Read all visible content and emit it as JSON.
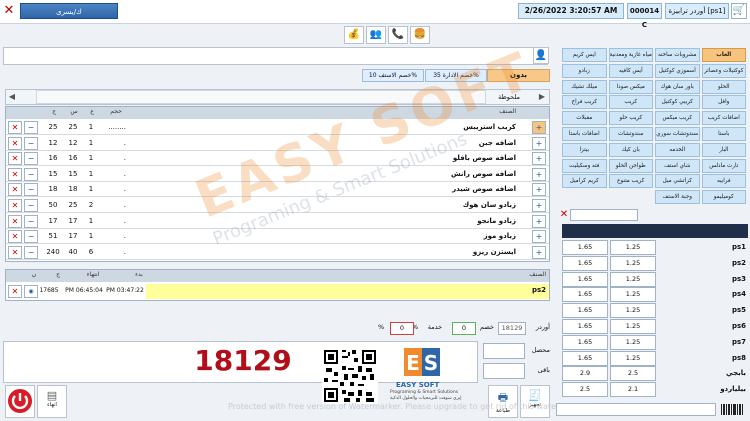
{
  "header": {
    "user": "ك/يسرى",
    "datetime": "2/26/2022 3:20:57 AM",
    "code": "000014 C",
    "title": "أوردر ترابيزة [ps1]"
  },
  "toolbar_icons": [
    "bag-icon",
    "cashier-icon",
    "phone-icon",
    "delivery-icon"
  ],
  "discounts": {
    "without": "بدون",
    "admin": "خصم الادارة 35%",
    "staff": "خصم الاستف 10%"
  },
  "order": {
    "note_label": "ملحوظة",
    "columns": {
      "item": "الصنف",
      "size": "حجم",
      "qty": "ع",
      "price": "س",
      "total": "ج"
    },
    "rows": [
      {
        "item": "كريب استريبس",
        "size": "........",
        "qty": "1",
        "price": "25",
        "total": "25"
      },
      {
        "item": "اضافه جبن",
        "size": ".",
        "qty": "1",
        "price": "12",
        "total": "12"
      },
      {
        "item": "اضافه صوص بافلو",
        "size": ".",
        "qty": "1",
        "price": "16",
        "total": "16"
      },
      {
        "item": "اضافه صوص رانش",
        "size": ".",
        "qty": "1",
        "price": "15",
        "total": "15"
      },
      {
        "item": "اضافه صوص شيدر",
        "size": ".",
        "qty": "1",
        "price": "18",
        "total": "18"
      },
      {
        "item": "زبادو سان هوك",
        "size": ".",
        "qty": "2",
        "price": "25",
        "total": "50"
      },
      {
        "item": "زبادو مانجو",
        "size": ".",
        "qty": "1",
        "price": "17",
        "total": "17"
      },
      {
        "item": "زبادو موز",
        "size": ".",
        "qty": "1",
        "price": "17",
        "total": "51"
      },
      {
        "item": "ايستزن ريزو",
        "size": ".",
        "qty": "6",
        "price": "40",
        "total": "240"
      }
    ]
  },
  "time_table": {
    "columns": {
      "item": "الصنف",
      "start": "بدء",
      "end": "انتهاء",
      "total": "ج",
      "n": "ن"
    },
    "row": {
      "item": "ps2",
      "start": "PM 03:47:22",
      "end": "PM 06:45:04",
      "total": "17685"
    }
  },
  "totals": {
    "order_label": "أوردر",
    "order_value": "18129",
    "discount_label": "خصم",
    "discount_value": "0",
    "service_label": "خدمة",
    "service_value": "0",
    "percent1": "%",
    "percent2": "%",
    "collected_label": "محصل",
    "remaining_label": "باقى",
    "grand_total": "18129"
  },
  "bottom_buttons": {
    "print": "طباعة",
    "prepare": "تجهيز",
    "end": "انهاء"
  },
  "categories": [
    [
      "العاب",
      "مشروبات ساخنه",
      "مياه غازية ومعدنية",
      "ايس كريم"
    ],
    [
      "كوكتيلات وعصائر",
      "أسموزي كوكتيل",
      "أيس كافيه",
      "زبادو"
    ],
    [
      "الحلو",
      "باور سان هوك",
      "ميكس صودا",
      "ميلك تشيك"
    ],
    [
      "وافل",
      "كريبي كوكتيل",
      "كريب",
      "كريب فراخ"
    ],
    [
      "اضافات كريب",
      "كريب ميكس",
      "كريب حلو",
      "مقبلات"
    ],
    [
      "باستا",
      "سندوتشات سوري",
      "سندوتشات",
      "اضافات باستا"
    ],
    [
      "البار",
      "الخدمه",
      "بان كيك",
      "بيتزا"
    ],
    [
      "تارت مادلس",
      "شاي استف",
      "طواجن الحلو",
      "فته وسكيليت"
    ],
    [
      "فرابيه",
      "كراتشي ميل",
      "كريب متنوع",
      "كريم كراميل"
    ],
    [
      "كوميليمو",
      "وجبة الاستف",
      "",
      ""
    ]
  ],
  "ps_table": [
    {
      "name": "ps1",
      "price1": "1.25",
      "price2": "1.65"
    },
    {
      "name": "ps2",
      "price1": "1.25",
      "price2": "1.65"
    },
    {
      "name": "ps3",
      "price1": "1.25",
      "price2": "1.65"
    },
    {
      "name": "ps4",
      "price1": "1.25",
      "price2": "1.65"
    },
    {
      "name": "ps5",
      "price1": "1.25",
      "price2": "1.65"
    },
    {
      "name": "ps6",
      "price1": "1.25",
      "price2": "1.65"
    },
    {
      "name": "ps7",
      "price1": "1.25",
      "price2": "1.65"
    },
    {
      "name": "ps8",
      "price1": "1.25",
      "price2": "1.65"
    },
    {
      "name": "بابجي",
      "price1": "2.5",
      "price2": "2.9"
    },
    {
      "name": "بيلياردو",
      "price1": "2.1",
      "price2": "2.5"
    }
  ],
  "branding": {
    "logo_text": "EASY SOFT",
    "logo_tagline": "Programing & Smart Solutions",
    "logo_arabic": "إيزي سوفت للبرمجيات والحلول الذكية",
    "watermark": "Protected with free version of Watermarker. Please upgrade to get rid of this watermark."
  },
  "colors": {
    "accent_blue": "#2e66a8",
    "orange": "#f6c47c",
    "light_blue": "#cfe6f8",
    "red_number": "#b00f1a"
  }
}
